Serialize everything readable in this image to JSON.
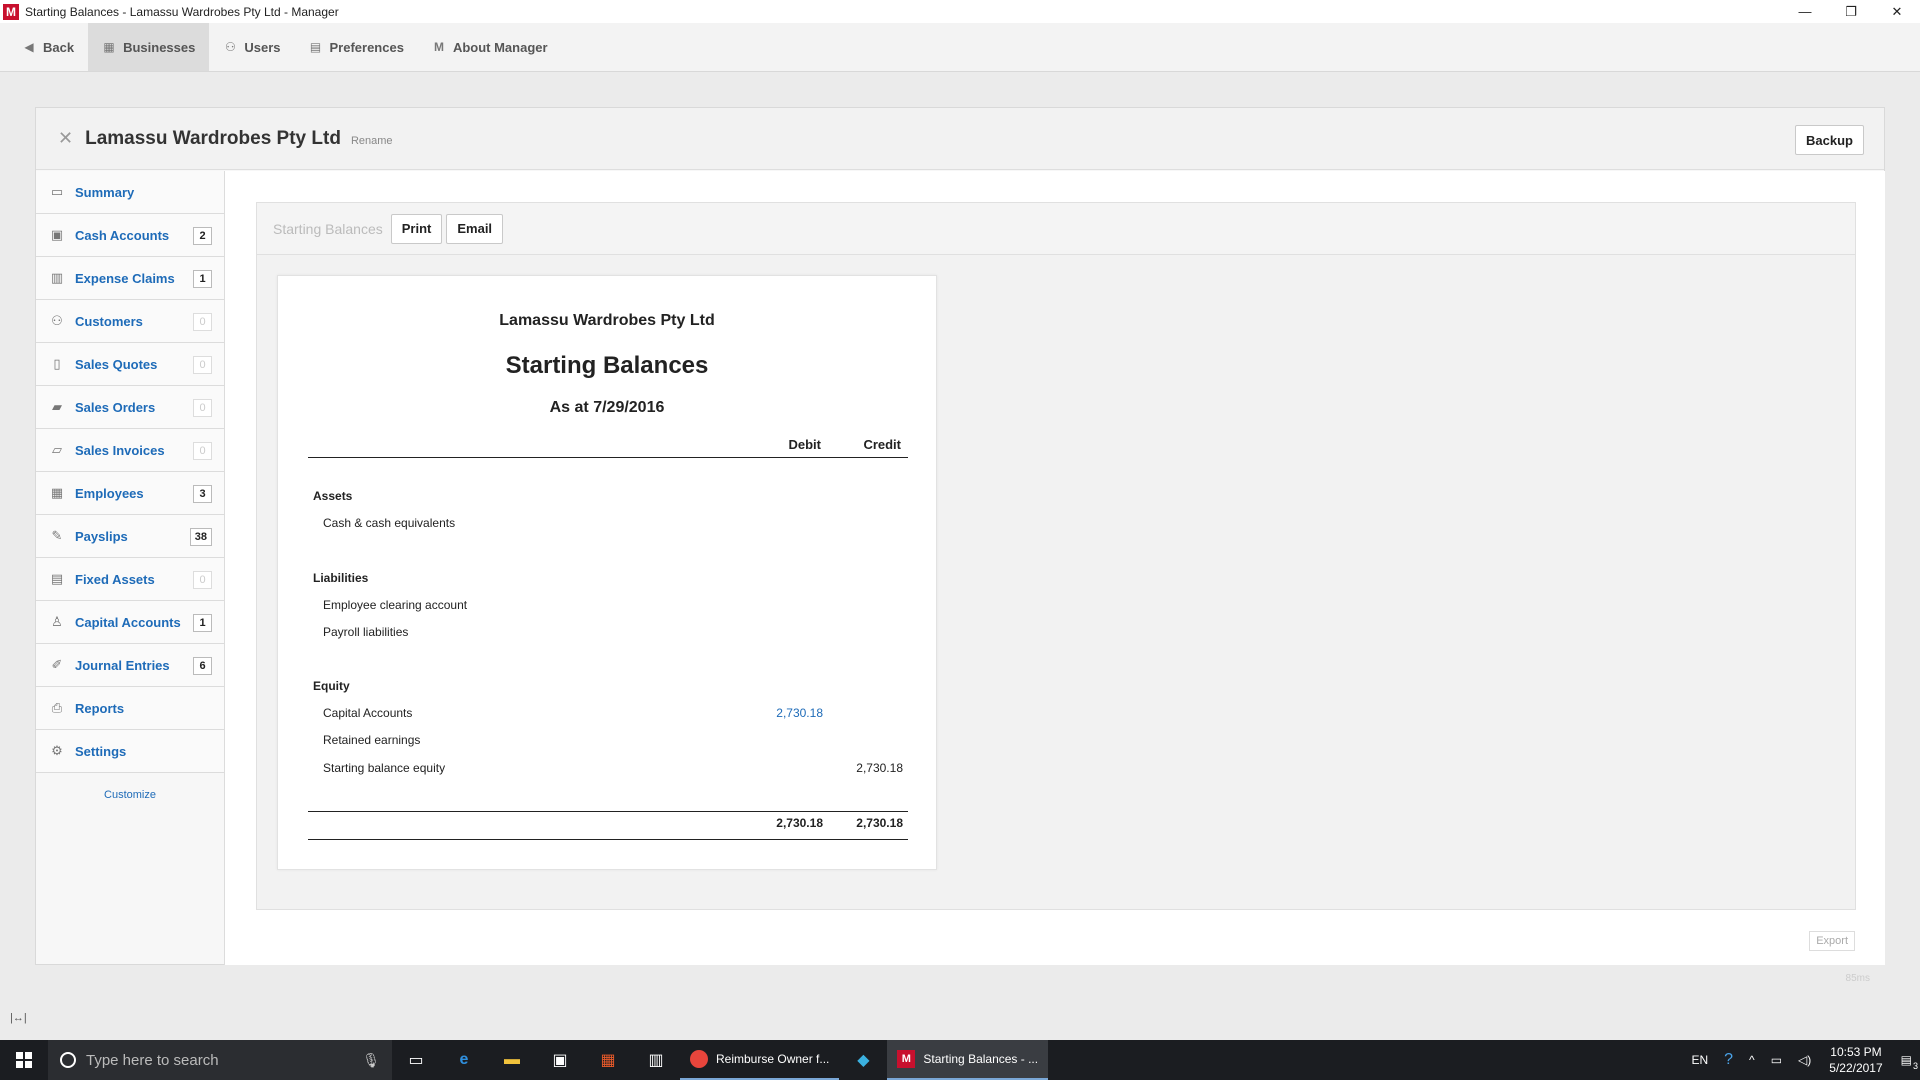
{
  "window": {
    "title": "Starting Balances - Lamassu Wardrobes Pty Ltd - Manager",
    "logo": "M",
    "minimize": "—",
    "maximize": "❐",
    "close": "✕"
  },
  "topnav": {
    "items": [
      {
        "label": "Back",
        "icon": "back-arrow-icon",
        "glyph": "◀"
      },
      {
        "label": "Businesses",
        "icon": "building-icon",
        "glyph": "▦"
      },
      {
        "label": "Users",
        "icon": "users-icon",
        "glyph": "⚇"
      },
      {
        "label": "Preferences",
        "icon": "preferences-icon",
        "glyph": "▤"
      },
      {
        "label": "About Manager",
        "icon": "manager-logo-icon",
        "glyph": "M"
      }
    ]
  },
  "business": {
    "name": "Lamassu Wardrobes Pty Ltd",
    "rename_label": "Rename",
    "close_glyph": "✕",
    "backup_label": "Backup"
  },
  "sidebar": {
    "items": [
      {
        "label": "Summary",
        "count": "",
        "glyph": "▭"
      },
      {
        "label": "Cash Accounts",
        "count": "2",
        "glyph": "▣"
      },
      {
        "label": "Expense Claims",
        "count": "1",
        "glyph": "▥"
      },
      {
        "label": "Customers",
        "count": "0",
        "glyph": "⚇"
      },
      {
        "label": "Sales Quotes",
        "count": "0",
        "glyph": "▯"
      },
      {
        "label": "Sales Orders",
        "count": "0",
        "glyph": "▰"
      },
      {
        "label": "Sales Invoices",
        "count": "0",
        "glyph": "▱"
      },
      {
        "label": "Employees",
        "count": "3",
        "glyph": "▦"
      },
      {
        "label": "Payslips",
        "count": "38",
        "glyph": "✎"
      },
      {
        "label": "Fixed Assets",
        "count": "0",
        "glyph": "▤"
      },
      {
        "label": "Capital Accounts",
        "count": "1",
        "glyph": "♙"
      },
      {
        "label": "Journal Entries",
        "count": "6",
        "glyph": "✐"
      },
      {
        "label": "Reports",
        "count": "",
        "glyph": "⎙"
      },
      {
        "label": "Settings",
        "count": "",
        "glyph": "⚙"
      }
    ],
    "customize_label": "Customize"
  },
  "report": {
    "breadcrumb": "Starting Balances",
    "print_label": "Print",
    "email_label": "Email",
    "company": "Lamassu Wardrobes Pty Ltd",
    "title": "Starting Balances",
    "date": "As at 7/29/2016",
    "col_debit": "Debit",
    "col_credit": "Credit",
    "groups": {
      "assets": "Assets",
      "liabilities": "Liabilities",
      "equity": "Equity"
    },
    "lines": {
      "cash": {
        "label": "Cash & cash equivalents",
        "debit": "",
        "credit": ""
      },
      "employee_clearing": {
        "label": "Employee clearing account",
        "debit": "",
        "credit": ""
      },
      "payroll": {
        "label": "Payroll liabilities",
        "debit": "",
        "credit": ""
      },
      "capital": {
        "label": "Capital Accounts",
        "debit": "2,730.18",
        "credit": ""
      },
      "retained": {
        "label": "Retained earnings",
        "debit": "",
        "credit": ""
      },
      "sbe": {
        "label": "Starting balance equity",
        "debit": "",
        "credit": "2,730.18"
      }
    },
    "total_debit": "2,730.18",
    "total_credit": "2,730.18",
    "export_label": "Export"
  },
  "footer": {
    "timing": "85ms",
    "resize_glyph": "|↔|"
  },
  "taskbar": {
    "search_placeholder": "Type here to search",
    "apps": [
      {
        "label": "Reimburse Owner f...",
        "icon": "chrome-icon"
      },
      {
        "label": "Starting Balances - ...",
        "icon": "manager-app-icon"
      }
    ],
    "lang": "EN",
    "time": "10:53 PM",
    "date": "5/22/2017",
    "notifications": "3"
  }
}
